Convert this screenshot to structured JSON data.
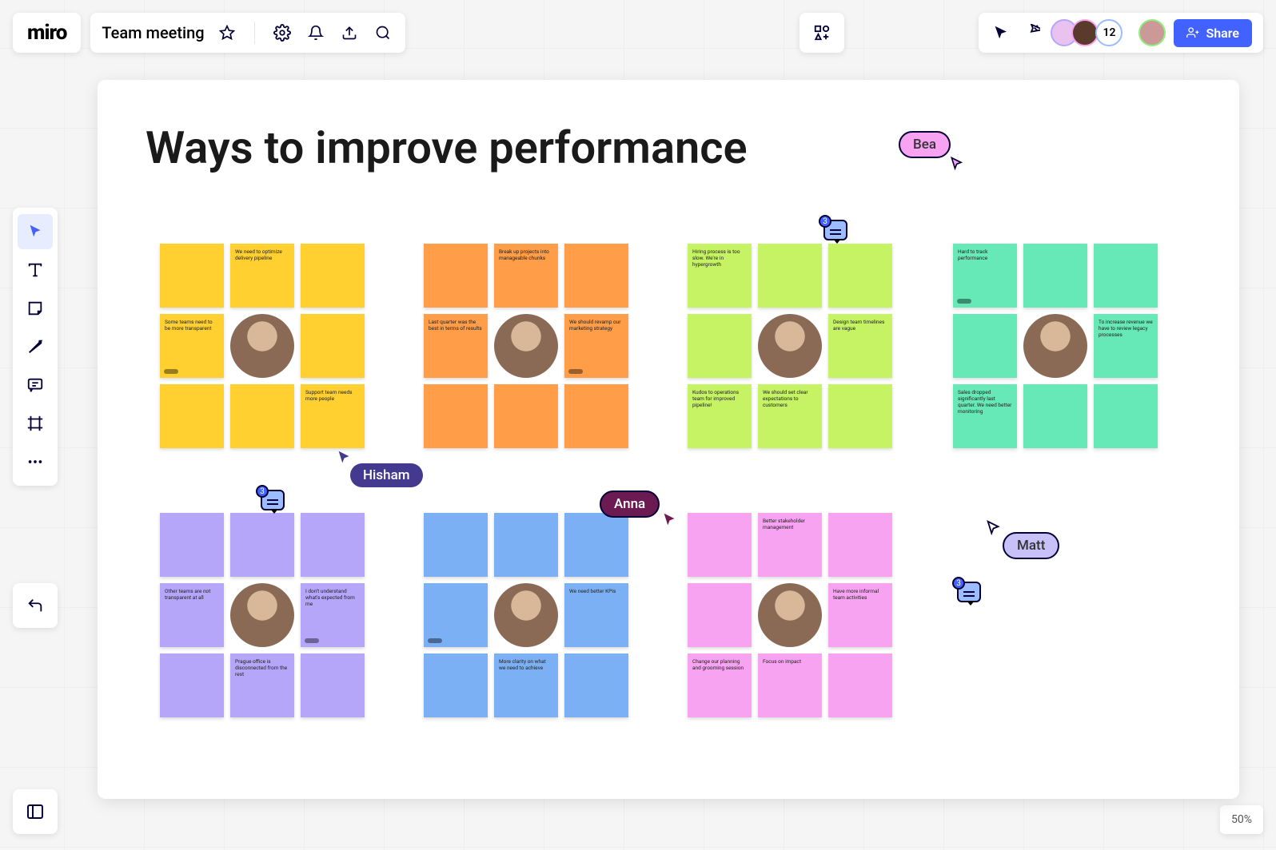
{
  "app": {
    "logo": "miro"
  },
  "header": {
    "board_title": "Team meeting",
    "share_label": "Share",
    "collaborator_overflow_count": "12"
  },
  "zoom": {
    "level": "50%"
  },
  "frame": {
    "title": "Ways to improve performance"
  },
  "cursors": {
    "bea": {
      "label": "Bea",
      "color": "#f7a3f2"
    },
    "hisham": {
      "label": "Hisham",
      "color": "#433a8f"
    },
    "anna": {
      "label": "Anna",
      "color": "#6b1a52"
    },
    "matt": {
      "label": "Matt",
      "color": "#c7c1f8"
    }
  },
  "comments": {
    "c1": "3",
    "c2": "3",
    "c3": "3"
  },
  "clusters": {
    "yellow": {
      "color": "yellow",
      "notes": [
        "",
        "We need to optimize delivery pipeline",
        "",
        "Some teams need to be more transparent",
        "FACE",
        "",
        "",
        "",
        "Support team needs more people"
      ],
      "tags": [
        false,
        false,
        false,
        true,
        false,
        false,
        false,
        false,
        false
      ]
    },
    "orange": {
      "color": "orange",
      "notes": [
        "",
        "Break up projects into manageable chunks",
        "",
        "Last quarter was the best in terms of results",
        "FACE",
        "We should revamp our marketing strategy",
        "",
        "",
        ""
      ],
      "tags": [
        false,
        false,
        false,
        false,
        false,
        true,
        false,
        false,
        false
      ]
    },
    "green": {
      "color": "green",
      "notes": [
        "Hiring process is too slow. We're in hypergrowth",
        "",
        "",
        "",
        "FACE",
        "Design team timelines are vague",
        "Kudos to operations team for improved pipeline!",
        "We should set clear expectations to customers",
        ""
      ],
      "tags": [
        false,
        false,
        false,
        false,
        false,
        false,
        false,
        false,
        false
      ]
    },
    "mint": {
      "color": "mint",
      "notes": [
        "Hard to track performance",
        "",
        "",
        "",
        "FACE",
        "To increase revenue we have to review legacy processes",
        "Sales dropped significantly last quarter. We need better monitoring",
        "",
        ""
      ],
      "tags": [
        true,
        false,
        false,
        false,
        false,
        false,
        false,
        false,
        false
      ]
    },
    "purple": {
      "color": "purple",
      "notes": [
        "",
        "",
        "",
        "Other teams are not transparent at all",
        "FACE",
        "I don't understand what's expected from me",
        "",
        "Prague office is disconnected from the rest",
        ""
      ],
      "tags": [
        false,
        false,
        false,
        false,
        false,
        true,
        false,
        false,
        false
      ]
    },
    "blue": {
      "color": "blue",
      "notes": [
        "",
        "",
        "",
        "",
        "FACE",
        "We need better KPIs",
        "",
        "More clarity on what we need to achieve",
        ""
      ],
      "tags": [
        false,
        false,
        false,
        true,
        false,
        false,
        false,
        false,
        false
      ]
    },
    "pink": {
      "color": "pink",
      "notes": [
        "",
        "Better stakeholder management",
        "",
        "",
        "FACE",
        "Have more informal team activities",
        "Change our planning and grooming session",
        "Focus on impact",
        ""
      ],
      "tags": [
        false,
        false,
        false,
        false,
        false,
        false,
        false,
        false,
        false
      ]
    }
  }
}
